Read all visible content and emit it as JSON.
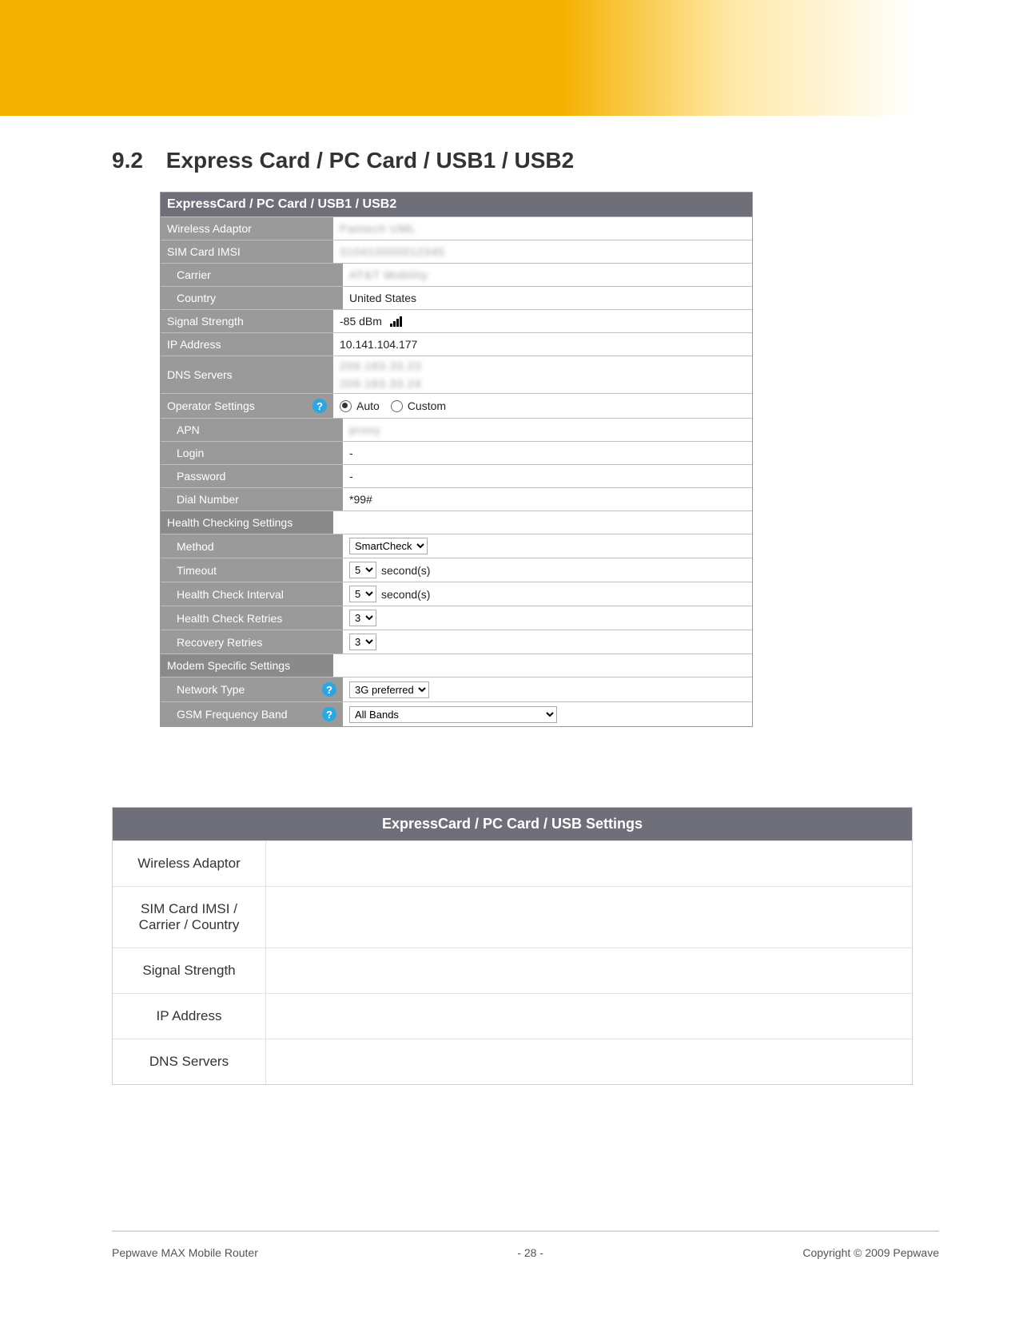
{
  "heading": {
    "number": "9.2",
    "title": "Express Card / PC Card / USB1 / USB2"
  },
  "ui": {
    "title": "ExpressCard / PC Card / USB1 / USB2",
    "rows": {
      "wireless_adaptor": {
        "label": "Wireless Adaptor",
        "value": "Pantech UML"
      },
      "sim_imsi": {
        "label": "SIM Card IMSI",
        "value": "310410000012345"
      },
      "carrier": {
        "label": "Carrier",
        "value": "AT&T Mobility"
      },
      "country": {
        "label": "Country",
        "value": "United States"
      },
      "signal": {
        "label": "Signal Strength",
        "value": "-85 dBm"
      },
      "ip": {
        "label": "IP Address",
        "value": "10.141.104.177"
      },
      "dns": {
        "label": "DNS Servers",
        "line1": "209.183.33.23",
        "line2": "209.183.33.24"
      },
      "operator": {
        "label": "Operator Settings",
        "opt_auto": "Auto",
        "opt_custom": "Custom"
      },
      "apn": {
        "label": "APN",
        "value": "proxy"
      },
      "login": {
        "label": "Login",
        "value": "-"
      },
      "password": {
        "label": "Password",
        "value": "-"
      },
      "dial": {
        "label": "Dial Number",
        "value": "*99#"
      },
      "health_header": {
        "label": "Health Checking Settings"
      },
      "method": {
        "label": "Method",
        "value": "SmartCheck"
      },
      "timeout": {
        "label": "Timeout",
        "value": "5",
        "suffix": "second(s)"
      },
      "interval": {
        "label": "Health Check Interval",
        "value": "5",
        "suffix": "second(s)"
      },
      "hretries": {
        "label": "Health Check Retries",
        "value": "3"
      },
      "rretries": {
        "label": "Recovery Retries",
        "value": "3"
      },
      "modem_header": {
        "label": "Modem Specific Settings"
      },
      "nettype": {
        "label": "Network Type",
        "value": "3G preferred"
      },
      "gsmband": {
        "label": "GSM Frequency Band",
        "value": "All Bands"
      }
    }
  },
  "desc": {
    "title": "ExpressCard / PC Card / USB Settings",
    "rows": [
      {
        "label": "Wireless Adaptor",
        "text": ""
      },
      {
        "label": "SIM Card IMSI / Carrier / Country",
        "text": ""
      },
      {
        "label": "Signal Strength",
        "text": ""
      },
      {
        "label": "IP Address",
        "text": ""
      },
      {
        "label": "DNS Servers",
        "text": ""
      }
    ]
  },
  "footer": {
    "left": "Pepwave MAX Mobile Router",
    "center": "- 28 -",
    "right": "Copyright © 2009 Pepwave"
  }
}
